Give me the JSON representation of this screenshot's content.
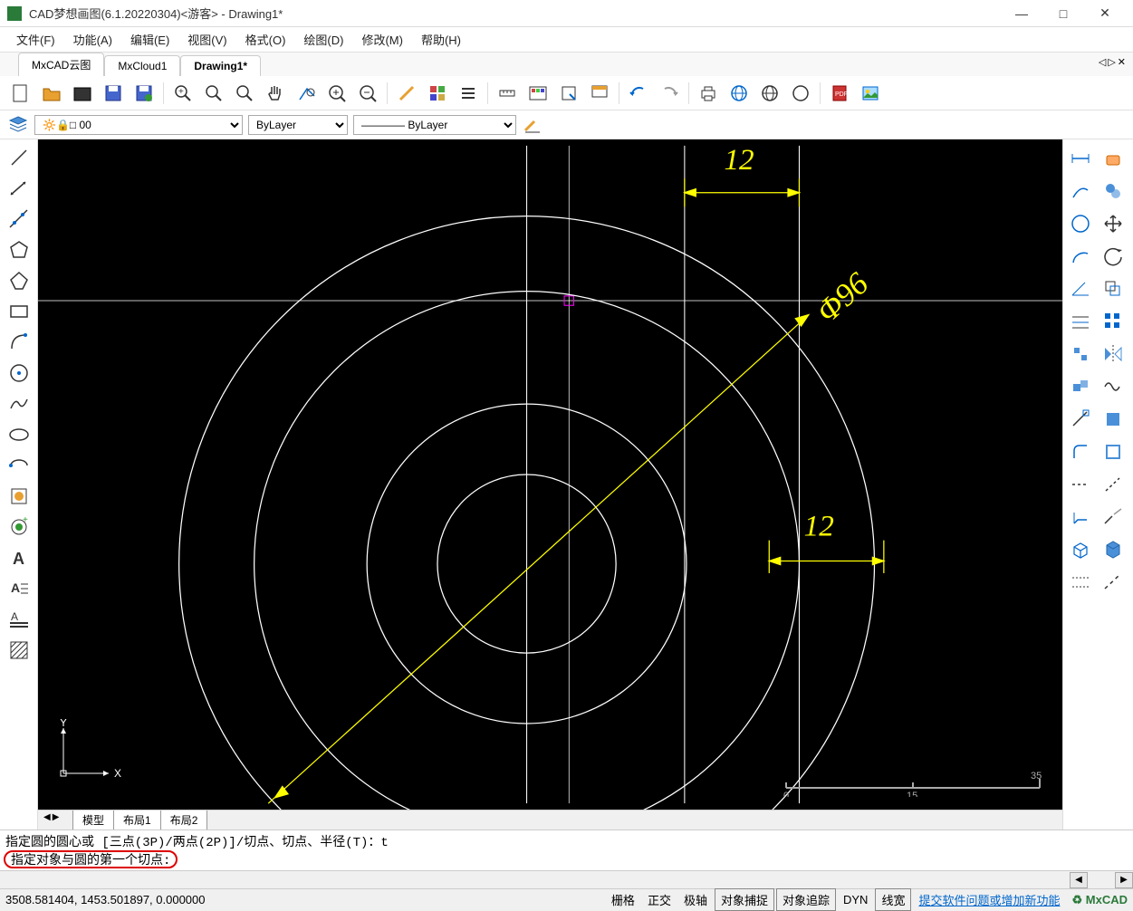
{
  "window": {
    "title": "CAD梦想画图(6.1.20220304)<游客> - Drawing1*",
    "minimize": "—",
    "maximize": "□",
    "close": "✕"
  },
  "menu": {
    "items": [
      "文件(F)",
      "功能(A)",
      "编辑(E)",
      "视图(V)",
      "格式(O)",
      "绘图(D)",
      "修改(M)",
      "帮助(H)"
    ]
  },
  "doc_tabs": {
    "items": [
      "MxCAD云图",
      "MxCloud1",
      "Drawing1*"
    ],
    "active_index": 2,
    "nav": [
      "◁",
      "▷",
      "✕"
    ]
  },
  "toolbar_main": {
    "icons": [
      "new-file",
      "open-file",
      "folder",
      "save",
      "save-as",
      "search-plus",
      "search-minus",
      "zoom-fit",
      "pan-hand",
      "zoom-window",
      "zoom-in",
      "zoom-out",
      "line-draw",
      "layers",
      "props-list",
      "measure",
      "layer-color",
      "select-rect",
      "export",
      "palette",
      "undo",
      "redo",
      "print",
      "globe",
      "web-globe",
      "web-page",
      "pdf-export",
      "image"
    ]
  },
  "layer_bar": {
    "layer_value": "0",
    "linetype_value": "ByLayer",
    "lineweight_value": "ByLayer"
  },
  "left_tools": [
    "line",
    "polyline",
    "xline",
    "polygon",
    "pentagon",
    "rect",
    "arc",
    "circle",
    "spline",
    "ellipse",
    "ellipse-arc",
    "block-insert",
    "block-ring",
    "text-a",
    "mtext",
    "mtext-line",
    "hatch"
  ],
  "right_tools": [
    "dim-linear",
    "erase",
    "dim-aligned",
    "copy",
    "dim-radius",
    "move",
    "dim-arc",
    "rotate",
    "dim-angle",
    "offset",
    "leader",
    "array-rect",
    "ordinate",
    "mirror",
    "block",
    "wave",
    "gradient",
    "trim",
    "fillet",
    "extend",
    "blue-rect",
    "scale",
    "dashed",
    "dashed2",
    "chamfer",
    "break",
    "box-3d",
    "cylinder",
    "dashed3",
    "dashed4"
  ],
  "canvas": {
    "dim1": "12",
    "dim2": "Φ96",
    "dim3": "12",
    "scale_0": "0",
    "scale_15": "15",
    "scale_35": "35",
    "ucs_x": "X",
    "ucs_y": "Y"
  },
  "layout_tabs": {
    "nav": [
      "◀",
      "▶"
    ],
    "items": [
      "模型",
      "布局1",
      "布局2"
    ]
  },
  "command": {
    "history": "指定圆的圆心或 [三点(3P)/两点(2P)]/切点、切点、半径(T)：t",
    "prompt": "指定对象与圆的第一个切点:"
  },
  "status": {
    "coords": "3508.581404, 1453.501897, 0.000000",
    "items": [
      "栅格",
      "正交",
      "极轴",
      "对象捕捉",
      "对象追踪",
      "DYN",
      "线宽"
    ],
    "boxed": [
      false,
      false,
      false,
      true,
      true,
      false,
      true
    ],
    "link": "提交软件问题或增加新功能",
    "brand": "MxCAD"
  }
}
